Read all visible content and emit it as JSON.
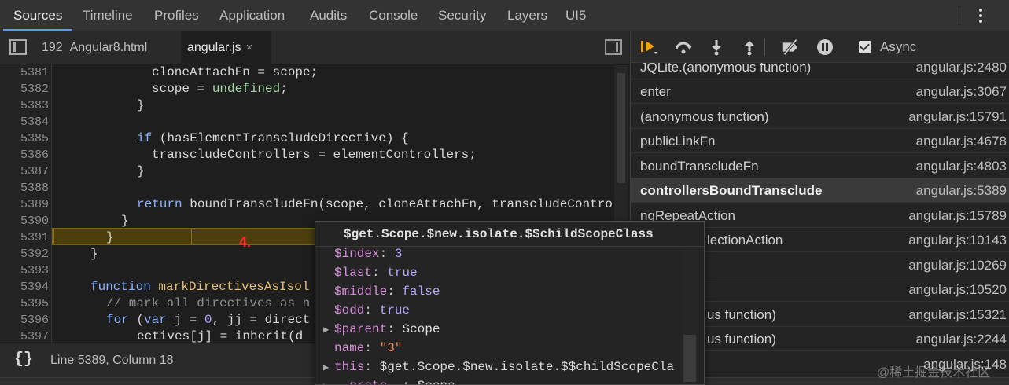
{
  "tabs": [
    "Sources",
    "Timeline",
    "Profiles",
    "Application",
    "Audits",
    "Console",
    "Security",
    "Layers",
    "UI5"
  ],
  "active_tab": "Sources",
  "menu_icon": "more-vertical-icon",
  "file_tabs": [
    {
      "label": "192_Angular8.html"
    },
    {
      "label": "angular.js",
      "close": "×"
    }
  ],
  "code_lines": [
    {
      "n": "5381"
    },
    {
      "n": "5382"
    },
    {
      "n": "5383"
    },
    {
      "n": "5384"
    },
    {
      "n": "5385"
    },
    {
      "n": "5386"
    },
    {
      "n": "5387"
    },
    {
      "n": "5388"
    },
    {
      "n": "5389"
    },
    {
      "n": "5390"
    },
    {
      "n": "5391"
    },
    {
      "n": "5392"
    },
    {
      "n": "5393"
    },
    {
      "n": "5394"
    },
    {
      "n": "5395"
    },
    {
      "n": "5396"
    },
    {
      "n": "5397"
    }
  ],
  "code": {
    "l5381": "cloneAttachFn = scope;",
    "l5382_a": "scope = ",
    "l5382_b": "undefined",
    "l5382_c": ";",
    "l5383": "}",
    "l5385_kw": "if",
    "l5385_rest": " (hasElementTranscludeDirective) {",
    "l5386": "transcludeControllers = elementControllers;",
    "l5387": "}",
    "l5389_kw": "return",
    "l5389_rest": " boundTranscludeFn(scope, cloneAttachFn, transcludeControl",
    "l5390": "}",
    "l5391": "}",
    "l5392": "}",
    "l5394_kw": "function",
    "l5394_rest": " markDirectivesAsIsol",
    "l5395": "// mark all directives as n",
    "l5396_kw": "for",
    "l5396_a": " (",
    "l5396_var": "var",
    "l5396_b": " j = ",
    "l5396_n0": "0",
    "l5396_c": ", jj = direct",
    "l5397": "ectives[j] = inherit(d"
  },
  "annotation": "4.",
  "status": {
    "icon": "braces-icon",
    "braces": "{}",
    "position": "Line 5389, Column 18"
  },
  "debugger": {
    "async_label": "Async",
    "async_checked": true,
    "buttons": [
      "resume-icon",
      "step-over-icon",
      "step-into-icon",
      "step-out-icon",
      "deactivate-breakpoints-icon",
      "pause-on-exceptions-icon"
    ]
  },
  "call_stack": [
    {
      "name": "JQLite.(anonymous function)",
      "loc": "angular.js:2480"
    },
    {
      "name": "enter",
      "loc": "angular.js:3067"
    },
    {
      "name": "(anonymous function)",
      "loc": "angular.js:15791"
    },
    {
      "name": "publicLinkFn",
      "loc": "angular.js:4678"
    },
    {
      "name": "boundTranscludeFn",
      "loc": "angular.js:4803"
    },
    {
      "name": "controllersBoundTransclude",
      "loc": "angular.js:5389",
      "selected": true
    },
    {
      "name": "ngRepeatAction",
      "loc": "angular.js:15789"
    },
    {
      "name": "lectionAction",
      "loc": "angular.js:10143"
    },
    {
      "name": "",
      "loc": "angular.js:10269"
    },
    {
      "name": "",
      "loc": "angular.js:10520"
    },
    {
      "name": "us function)",
      "loc": "angular.js:15321"
    },
    {
      "name": "us function)",
      "loc": "angular.js:2244"
    },
    {
      "name": "",
      "loc": "angular.js:148"
    }
  ],
  "popover": {
    "title": "$get.Scope.$new.isolate.$$childScopeClass",
    "props": [
      {
        "key": "$index",
        "value": "3",
        "type": "num",
        "expandable": false
      },
      {
        "key": "$last",
        "value": "true",
        "type": "bool",
        "expandable": false
      },
      {
        "key": "$middle",
        "value": "false",
        "type": "bool",
        "expandable": false
      },
      {
        "key": "$odd",
        "value": "true",
        "type": "bool",
        "expandable": false
      },
      {
        "key": "$parent",
        "value": "Scope",
        "type": "obj",
        "expandable": true
      },
      {
        "key": "name",
        "value": "\"3\"",
        "type": "str",
        "expandable": false
      },
      {
        "key": "this",
        "value": "$get.Scope.$new.isolate.$$childScopeCla",
        "type": "obj",
        "expandable": true
      },
      {
        "key": "__proto__",
        "value": "Scope",
        "type": "obj",
        "expandable": true
      }
    ]
  },
  "watermark": "@稀土掘金技术社区"
}
